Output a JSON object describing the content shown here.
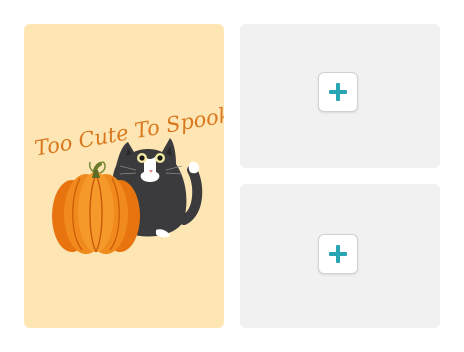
{
  "main_card": {
    "illustration": "cat-and-pumpkin",
    "caption": "Too Cute To Spook",
    "background_color": "#fde6b3",
    "text_color": "#d9781f"
  },
  "slots": [
    {
      "icon": "plus-icon",
      "accent_color": "#2aa5b4"
    },
    {
      "icon": "plus-icon",
      "accent_color": "#2aa5b4"
    }
  ]
}
